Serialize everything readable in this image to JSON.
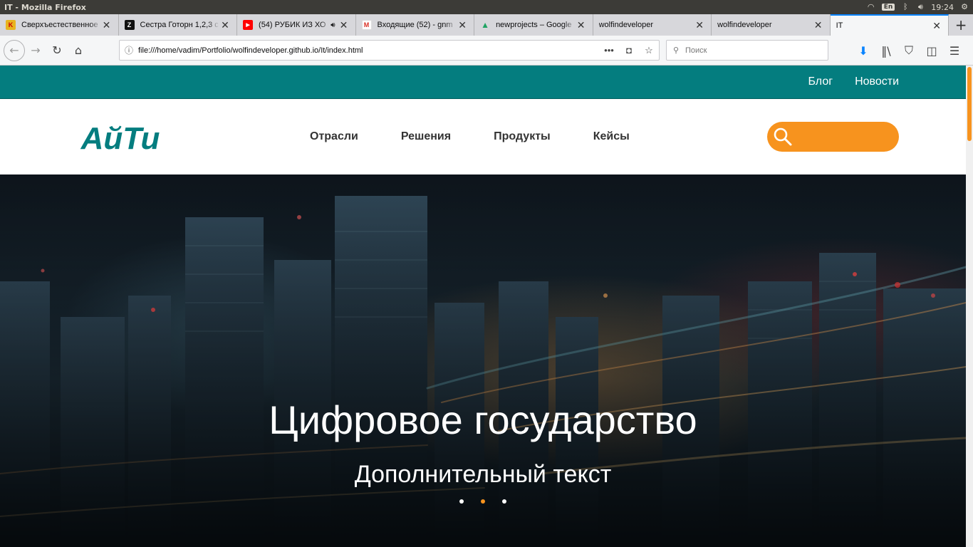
{
  "os": {
    "window_title": "IT - Mozilla Firefox",
    "lang": "En",
    "time": "19:24"
  },
  "tabs": [
    {
      "label": "Сверхъестественное",
      "fav_color": "#e8b41f",
      "fav_text": "K"
    },
    {
      "label": "Сестра Готорн 1,2,3 с",
      "fav_color": "#111111",
      "fav_text": "Z"
    },
    {
      "label": "(54) РУБИК ИЗ ХО",
      "fav_color": "#ff0000",
      "fav_text": "▶"
    },
    {
      "label": "Входящие (52) - gnm",
      "fav_color": "#ffffff",
      "fav_text": "M"
    },
    {
      "label": "newprojects – Google",
      "fav_color": "#1fa463",
      "fav_text": "▲"
    },
    {
      "label": "wolfindeveloper",
      "fav_color": "",
      "fav_text": ""
    },
    {
      "label": "wolfindeveloper",
      "fav_color": "",
      "fav_text": ""
    },
    {
      "label": "IT",
      "fav_color": "",
      "fav_text": ""
    }
  ],
  "navbar": {
    "url": "file:///home/vadim/Portfolio/wolfindeveloper.github.io/It/index.html",
    "search_placeholder": "Поиск"
  },
  "site": {
    "top_links": [
      "Блог",
      "Новости"
    ],
    "logo_text": "АйТи",
    "nav": [
      "Отрасли",
      "Решения",
      "Продукты",
      "Кейсы"
    ],
    "hero_title": "Цифровое государство",
    "hero_subtitle": "Дополнительный текст",
    "slides": 3,
    "active_slide": 1,
    "colors": {
      "teal": "#047d7f",
      "orange": "#f7931e"
    }
  }
}
